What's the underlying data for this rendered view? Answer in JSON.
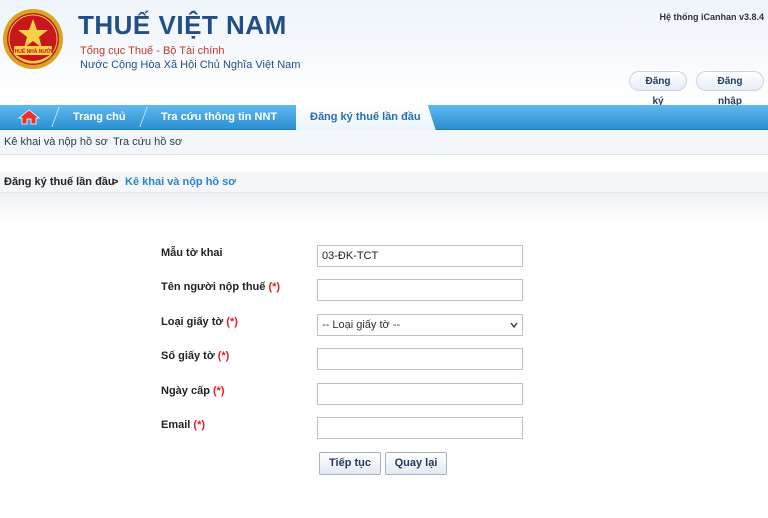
{
  "header": {
    "title": "THUẾ VIỆT NAM",
    "subtitle_1": "Tổng cục Thuế - Bộ Tài chính",
    "subtitle_2": "Nước Cộng Hòa Xã Hội Chủ Nghĩa Việt Nam",
    "version": "Hệ thống iCanhan v3.8.4",
    "emblem_text": "THUẾ NHÀ NƯỚC",
    "register_label": "Đăng ký",
    "login_label": "Đăng nhập"
  },
  "nav": {
    "home_icon": "home-icon",
    "items": [
      {
        "label": "Trang chủ"
      },
      {
        "label": "Tra cứu thông tin NNT"
      },
      {
        "label": "Đăng ký thuế lần đầu"
      }
    ]
  },
  "subnav": {
    "items": [
      {
        "label": "Kê khai và nộp hồ sơ"
      },
      {
        "label": "Tra cứu hồ sơ"
      }
    ]
  },
  "breadcrumb": {
    "root": "Đăng ký thuế lần đầu",
    "separator": ">",
    "current": "Kê khai và nộp hồ sơ"
  },
  "form": {
    "required_mark": "(*)",
    "fields": [
      {
        "label": "Mẫu tờ khai",
        "value": "03-ĐK-TCT"
      },
      {
        "label": "Tên người nộp thuế",
        "value": ""
      },
      {
        "label": "Loại giấy tờ",
        "value": "-- Loại giấy tờ --"
      },
      {
        "label": "Số giấy tờ",
        "value": ""
      },
      {
        "label": "Ngày cấp",
        "value": ""
      },
      {
        "label": "Email",
        "value": ""
      }
    ],
    "continue_label": "Tiếp tục",
    "back_label": "Quay lại"
  },
  "colors": {
    "brand_blue": "#1f4f86",
    "nav_blue": "#2c8fd3",
    "required_red": "#e02020",
    "link_blue": "#2a86c8"
  }
}
